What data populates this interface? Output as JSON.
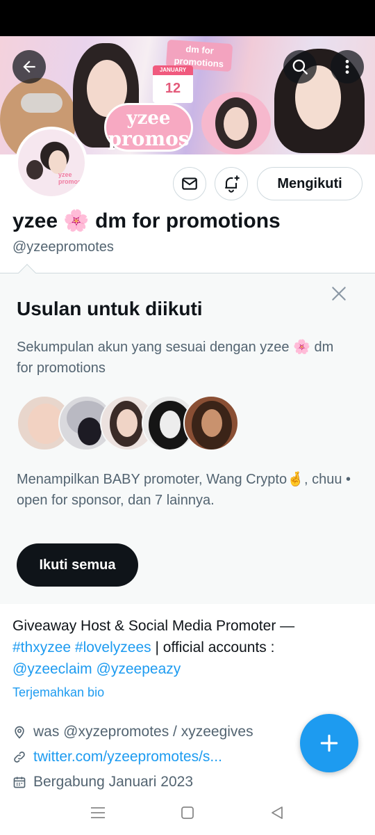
{
  "header": {
    "banner_calendar_month": "JANUARY",
    "banner_calendar_day": "12",
    "banner_tag": "dm for promotions",
    "banner_promos_line1": "yzee",
    "banner_promos_line2": "promos",
    "avatar_text": "yzee promos"
  },
  "actions": {
    "follow_label": "Mengikuti"
  },
  "profile": {
    "display_name": "yzee 🌸 dm for promotions",
    "handle": "@yzeepromotes"
  },
  "suggestions": {
    "title": "Usulan untuk diikuti",
    "description": "Sekumpulan akun yang sesuai dengan yzee 🌸 dm for promotions",
    "shown": "Menampilkan BABY promoter, Wang Crypto🤞, chuu • open for sponsor, dan 7 lainnya.",
    "follow_all_label": "Ikuti semua",
    "faces": [
      "baby",
      "anime",
      "girl-1",
      "girl-2",
      "girl-3"
    ]
  },
  "bio": {
    "line1": "Giveaway Host & Social Media Promoter —",
    "tag1": "#thxyzee",
    "tag2": "#lovelyzees",
    "line2_rest": " | official accounts :",
    "mention1": "@yzeeclaim",
    "mention2": "@yzeepeazy",
    "translate_label": "Terjemahkan bio"
  },
  "meta": {
    "location": "was @xyzepromotes / xyzeegives",
    "url": "twitter.com/yzeepromotes/s...",
    "joined": "Bergabung Januari 2023"
  },
  "colors": {
    "accent": "#1d9bf0",
    "text_primary": "#0f1419",
    "text_secondary": "#536471",
    "panel_bg": "#f7f9f9"
  }
}
